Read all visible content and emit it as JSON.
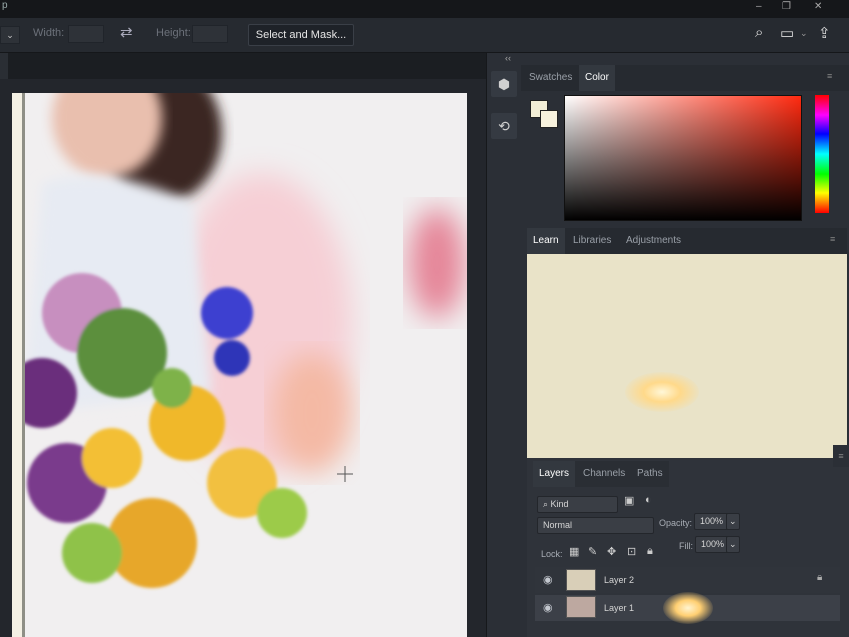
{
  "options_bar": {
    "width_label": "Width:",
    "height_label": "Height:",
    "select_mask_label": "Select and Mask..."
  },
  "top_icons": {
    "dock_collapse": "‹‹",
    "swap_icon": "⇄",
    "search_icon": "⌕",
    "workspace_icon": "▭",
    "share_icon": "⇪",
    "min_icon": "–",
    "restore_icon": "❐",
    "close_icon": "✕"
  },
  "color_panel": {
    "tabs": [
      "Swatches",
      "Color"
    ],
    "active_tab": "Color"
  },
  "learn_panel": {
    "tabs": [
      "Learn",
      "Libraries",
      "Adjustments"
    ],
    "active_tab": "Learn"
  },
  "layers_panel": {
    "tabs": [
      "Layers",
      "Channels",
      "Paths"
    ],
    "active_tab": "Layers",
    "filter_kind": "Kind",
    "blend_mode": "Normal",
    "opacity_label": "Opacity:",
    "opacity_value": "100%",
    "lock_label": "Lock:",
    "fill_label": "Fill:",
    "fill_value": "100%",
    "layers": [
      {
        "name": "Layer 2",
        "visible": true
      },
      {
        "name": "Layer 1",
        "visible": true
      }
    ]
  },
  "colors": {
    "accent": "#ff2a10",
    "panel_bg": "#2b2f36",
    "learn_bg": "#e9e3c8"
  }
}
